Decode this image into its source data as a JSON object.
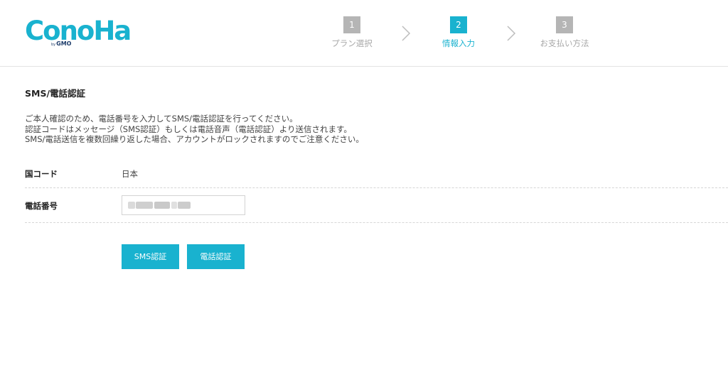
{
  "header": {
    "logo": {
      "main": "ConoHa",
      "by_prefix": "by",
      "by_brand": "GMO"
    },
    "steps": [
      {
        "num": "1",
        "label": "プラン選択",
        "active": false
      },
      {
        "num": "2",
        "label": "情報入力",
        "active": true
      },
      {
        "num": "3",
        "label": "お支払い方法",
        "active": false
      }
    ]
  },
  "main": {
    "title": "SMS/電話認証",
    "description": [
      "ご本人確認のため、電話番号を入力してSMS/電話認証を行ってください。",
      "認証コードはメッセージ（SMS認証）もしくは電話音声（電話認証）より送信されます。",
      "SMS/電話送信を複数回繰り返した場合、アカウントがロックされますのでご注意ください。"
    ],
    "fields": {
      "country_label": "国コード",
      "country_value": "日本",
      "phone_label": "電話番号",
      "phone_value": ""
    },
    "buttons": {
      "sms": "SMS認証",
      "phone": "電話認証"
    }
  },
  "colors": {
    "accent": "#19b2cf",
    "step_inactive": "#b5b5b5",
    "logo_secondary": "#1e3d6b"
  }
}
